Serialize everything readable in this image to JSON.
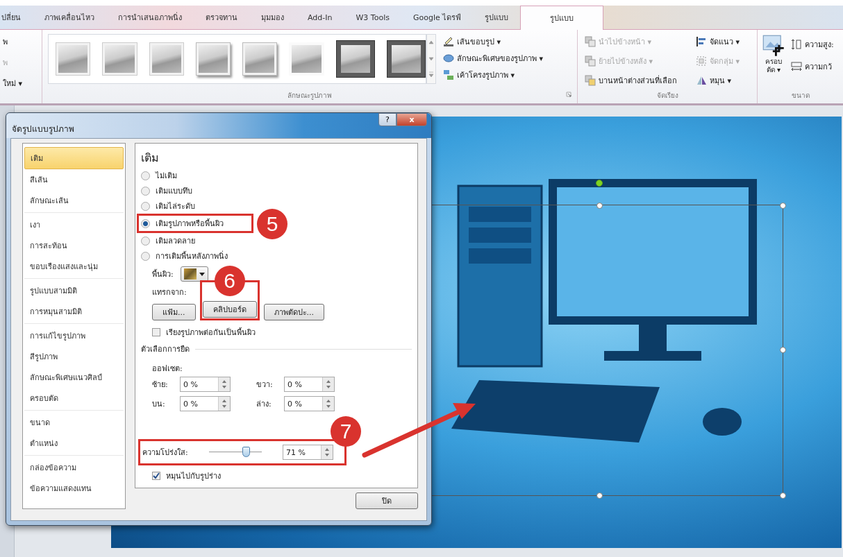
{
  "ribbon": {
    "tabs": [
      {
        "label": "ปลี่ยน",
        "selected": false
      },
      {
        "label": "ภาพเคลื่อนไหว",
        "selected": false
      },
      {
        "label": "การนำเสนอภาพนิ่ง",
        "selected": false
      },
      {
        "label": "ตรวจทาน",
        "selected": false
      },
      {
        "label": "มุมมอง",
        "selected": false
      },
      {
        "label": "Add-In",
        "selected": false
      },
      {
        "label": "W3 Tools",
        "selected": false
      },
      {
        "label": "Google ไดรฟ์",
        "selected": false
      },
      {
        "label": "รูปแบบ",
        "selected": false
      },
      {
        "label": "รูปแบบ",
        "selected": true
      }
    ],
    "cut_group": {
      "items": [
        {
          "label": "พ",
          "disabled": false
        },
        {
          "label": "พ",
          "disabled": true
        },
        {
          "label": "ใหม่ ▾",
          "disabled": false
        }
      ]
    },
    "styles_group": {
      "label": "ลักษณะรูปภาพ",
      "styles": [
        {
          "kind": "plain",
          "selected": false
        },
        {
          "kind": "plain",
          "selected": false
        },
        {
          "kind": "plain",
          "selected": false
        },
        {
          "kind": "shadow",
          "selected": false
        },
        {
          "kind": "shadow",
          "selected": false
        },
        {
          "kind": "soft",
          "selected": false
        },
        {
          "kind": "frame",
          "selected": false
        },
        {
          "kind": "frame",
          "selected": false
        }
      ],
      "commands": [
        {
          "kind": "border",
          "label": "เส้นขอบรูป ▾"
        },
        {
          "kind": "effects",
          "label": "ลักษณะพิเศษของรูปภาพ ▾"
        },
        {
          "kind": "layout",
          "label": "เค้าโครงรูปภาพ ▾"
        }
      ]
    },
    "arrange_group": {
      "label": "จัดเรียง",
      "commands": [
        {
          "kind": "front",
          "label": "นำไปข้างหน้า ▾",
          "disabled": true
        },
        {
          "kind": "align",
          "label": "จัดแนว ▾",
          "disabled": false
        },
        {
          "kind": "back",
          "label": "ย้ายไปข้างหลัง ▾",
          "disabled": true
        },
        {
          "kind": "group",
          "label": "จัดกลุ่ม ▾",
          "disabled": true
        },
        {
          "kind": "pane",
          "label": "บานหน้าต่างส่วนที่เลือก",
          "disabled": false
        },
        {
          "kind": "rotate",
          "label": "หมุน ▾",
          "disabled": false
        }
      ]
    },
    "size_group": {
      "label": "ขนาด",
      "crop_label": "ครอบ\nตัด ▾",
      "height_label": "ความสูง:",
      "width_label": "ความกว้"
    }
  },
  "dialog": {
    "title": "จัดรูปแบบรูปภาพ",
    "help": "?",
    "close": "x",
    "sidebar": [
      [
        {
          "label": "เติม",
          "selected": true
        },
        {
          "label": "สีเส้น",
          "selected": false
        },
        {
          "label": "ลักษณะเส้น",
          "selected": false
        }
      ],
      [
        {
          "label": "เงา",
          "selected": false
        },
        {
          "label": "การสะท้อน",
          "selected": false
        },
        {
          "label": "ขอบเรืองแสงและนุ่ม",
          "selected": false
        }
      ],
      [
        {
          "label": "รูปแบบสามมิติ",
          "selected": false
        },
        {
          "label": "การหมุนสามมิติ",
          "selected": false
        }
      ],
      [
        {
          "label": "การแก้ไขรูปภาพ",
          "selected": false
        },
        {
          "label": "สีรูปภาพ",
          "selected": false
        },
        {
          "label": "ลักษณะพิเศษแนวศิลป์",
          "selected": false
        },
        {
          "label": "ครอบตัด",
          "selected": false
        }
      ],
      [
        {
          "label": "ขนาด",
          "selected": false
        },
        {
          "label": "ตำแหน่ง",
          "selected": false
        }
      ],
      [
        {
          "label": "กล่องข้อความ",
          "selected": false
        },
        {
          "label": "ข้อความแสดงแทน",
          "selected": false
        }
      ]
    ],
    "heading": "เติม",
    "fill_options": [
      {
        "label": "ไม่เติม",
        "selected": false
      },
      {
        "label": "เติมแบบทึบ",
        "selected": false
      },
      {
        "label": "เติมไล่ระดับ",
        "selected": false
      },
      {
        "label": "เติมรูปภาพหรือพื้นผิว",
        "selected": true,
        "marker": "5"
      },
      {
        "label": "เติมลวดลาย",
        "selected": false
      },
      {
        "label": "การเติมพื้นหลังภาพนิ่ง",
        "selected": false
      }
    ],
    "texture_label": "พื้นผิว:",
    "insert_label": "แทรกจาก:",
    "insert_buttons": [
      {
        "label": "แฟ้ม..."
      },
      {
        "label": "คลิปบอร์ด",
        "marker": "6"
      },
      {
        "label": "ภาพตัดปะ..."
      }
    ],
    "tile": {
      "label": "เรียงรูปภาพต่อกันเป็นพื้นผิว",
      "checked": false
    },
    "stretch_label": "ตัวเลือกการยืด",
    "offset_label": "ออฟเซต:",
    "offsets": [
      {
        "label": "ซ้าย:",
        "value": "0 %"
      },
      {
        "label": "ขวา:",
        "value": "0 %"
      },
      {
        "label": "บน:",
        "value": "0 %"
      },
      {
        "label": "ล่าง:",
        "value": "0 %"
      }
    ],
    "transparency": {
      "label": "ความโปร่งใส:",
      "level": 0.71,
      "value": "71 %",
      "marker": "7"
    },
    "rotate": {
      "label": "หมุนไปกับรูปร่าง",
      "checked": true
    },
    "close_button": "ปิด"
  }
}
